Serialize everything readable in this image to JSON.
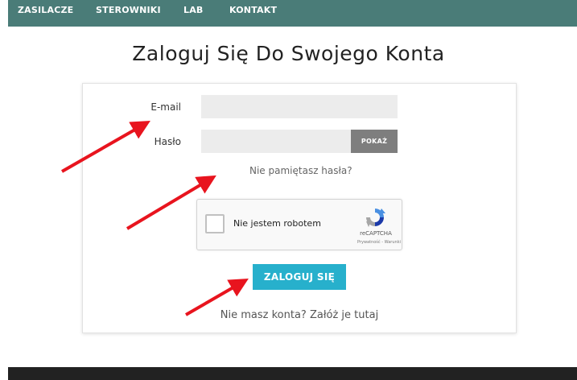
{
  "nav": {
    "items": [
      "ZASILACZE",
      "STEROWNIKI",
      "LAB",
      "KONTAKT"
    ]
  },
  "page": {
    "title": "Zaloguj Się Do Swojego Konta"
  },
  "form": {
    "email_label": "E-mail",
    "email_value": "",
    "password_label": "Hasło",
    "password_value": "",
    "show_button": "POKAŻ",
    "forgot_link": "Nie pamiętasz hasła?",
    "login_button": "ZALOGUJ SIĘ",
    "register_link": "Nie masz konta? Załóż je tutaj"
  },
  "recaptcha": {
    "label": "Nie jestem robotem",
    "brand": "reCAPTCHA",
    "links": "Prywatność - Warunki"
  },
  "colors": {
    "nav_bg": "#4a7c78",
    "login_button": "#27b0cc",
    "show_button": "#7e7e7e",
    "annotation_arrow": "#e8141e"
  }
}
